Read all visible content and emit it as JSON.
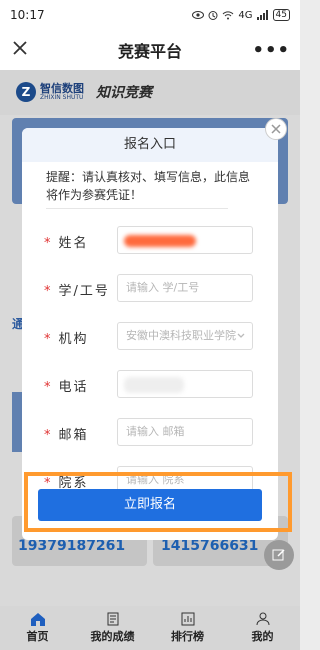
{
  "status": {
    "time": "10:17",
    "network": "4G",
    "battery": "45"
  },
  "titlebar": {
    "title": "竞赛平台",
    "more": "•••"
  },
  "brand": {
    "name": "智信数图",
    "sub": "ZHIXIN SHUTU",
    "slogan": "知识竞赛"
  },
  "background": {
    "side_text": "通",
    "phone_left": "19379187261",
    "phone_right": "1415766631"
  },
  "modal": {
    "title": "报名入口",
    "tip": "提醒：请认真核对、填写信息，此信息将作为参赛凭证！",
    "required_mark": "*",
    "fields": [
      {
        "label": "姓名",
        "value": "",
        "placeholder": ""
      },
      {
        "label": "学/工号",
        "value": "",
        "placeholder": "请输入 学/工号"
      },
      {
        "label": "机构",
        "value": "安徽中澳科技职业学院",
        "placeholder": ""
      },
      {
        "label": "电话",
        "value": "",
        "placeholder": ""
      },
      {
        "label": "邮箱",
        "value": "",
        "placeholder": "请输入 邮箱"
      },
      {
        "label": "院系",
        "value": "",
        "placeholder": "请输入 院系"
      }
    ],
    "submit_label": "立即报名"
  },
  "tabs": [
    {
      "label": "首页",
      "icon": "home-icon"
    },
    {
      "label": "我的成绩",
      "icon": "document-icon"
    },
    {
      "label": "排行榜",
      "icon": "chart-icon"
    },
    {
      "label": "我的",
      "icon": "person-icon"
    }
  ],
  "colors": {
    "primary": "#1f6fe0",
    "highlight": "#ff9a2e",
    "required": "#e03131"
  }
}
